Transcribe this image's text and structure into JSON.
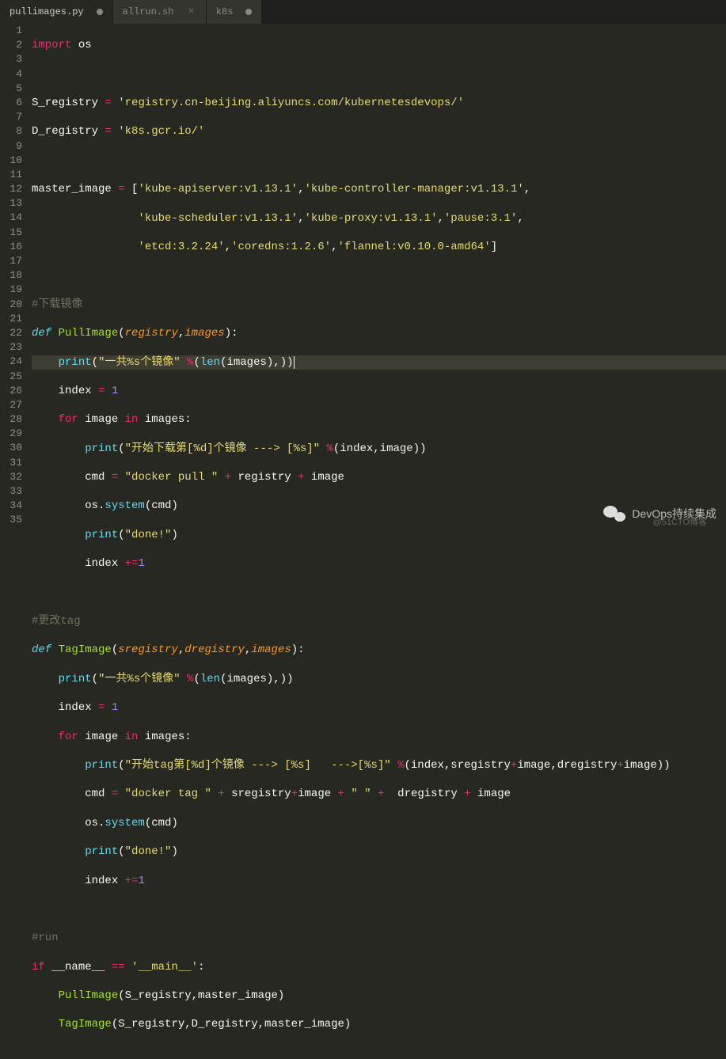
{
  "tabs": {
    "t0": {
      "label": "pullimages.py",
      "modified": true,
      "active": true
    },
    "t1": {
      "label": "allrun.sh",
      "modified": false,
      "active": false
    },
    "t2": {
      "label": "k8s",
      "modified": true,
      "active": false
    }
  },
  "lines": {
    "l1": 1,
    "l2": 2,
    "l3": 3,
    "l4": 4,
    "l5": 5,
    "l6": 6,
    "l7": 7,
    "l8": 8,
    "l9": 9,
    "l10": 10,
    "l11": 11,
    "l12": 12,
    "l13": 13,
    "l14": 14,
    "l15": 15,
    "l16": 16,
    "l17": 17,
    "l18": 18,
    "l19": 19,
    "l20": 20,
    "l21": 21,
    "l22": 22,
    "l23": 23,
    "l24": 24,
    "l25": 25,
    "l26": 26,
    "l27": 27,
    "l28": 28,
    "l29": 29,
    "l30": 30,
    "l31": 31,
    "l32": 32,
    "l33": 33,
    "l34": 34,
    "l35": 35
  },
  "code": {
    "import": "import",
    "os": "os",
    "def": "def",
    "for": "for",
    "in": "in",
    "if": "if",
    "S_registry": "S_registry",
    "D_registry": "D_registry",
    "master_image": "master_image",
    "PullImage": "PullImage",
    "TagImage": "TagImage",
    "registry": "registry",
    "images": "images",
    "sregistry": "sregistry",
    "dregistry": "dregistry",
    "image": "image",
    "index": "index",
    "cmd": "cmd",
    "print": "print",
    "len": "len",
    "system": "system",
    "name": "__name__",
    "eq": "=",
    "eqeq": "==",
    "plus": "+",
    "pluseq": "+=",
    "pcts": "%",
    "n1": "1",
    "s_reg": "'registry.cn-beijing.aliyuncs.com/kubernetesdevops/'",
    "d_reg": "'k8s.gcr.io/'",
    "img1": "'kube-apiserver:v1.13.1'",
    "img2": "'kube-controller-manager:v1.13.1'",
    "img3": "'kube-scheduler:v1.13.1'",
    "img4": "'kube-proxy:v1.13.1'",
    "img5": "'pause:3.1'",
    "img6": "'etcd:3.2.24'",
    "img7": "'coredns:1.2.6'",
    "img8": "'flannel:v0.10.0-amd64'",
    "cmt_dl": "#下载镜像",
    "cmt_tag": "#更改tag",
    "cmt_run": "#run",
    "str_total": "\"一共%s个镜像\"",
    "str_start_dl": "\"开始下载第[%d]个镜像 ---> [%s]\"",
    "str_start_tag": "\"开始tag第[%d]个镜像 ---> [%s]   --->[%s]\"",
    "str_docker_pull": "\"docker pull \"",
    "str_docker_tag": "\"docker tag \"",
    "str_space": "\" \"",
    "str_done": "\"done!\"",
    "str_main": "'__main__'"
  },
  "watermark": {
    "main": "DevOps持续集成",
    "sub": "@51CTO博客"
  }
}
